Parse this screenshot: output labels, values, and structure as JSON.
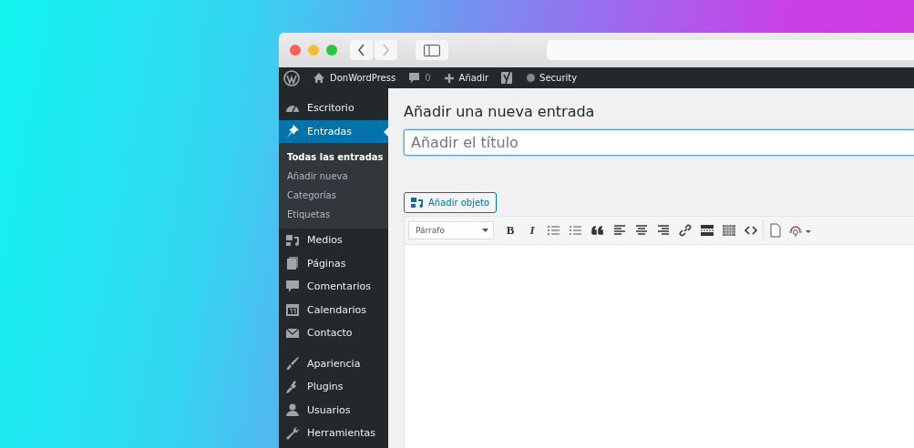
{
  "admin_bar": {
    "items": [
      {
        "kind": "home",
        "label": "DonWordPress"
      },
      {
        "kind": "comments",
        "label": "0"
      },
      {
        "kind": "add",
        "label": "Añadir"
      },
      {
        "kind": "seo"
      },
      {
        "kind": "security",
        "label": "Security"
      }
    ]
  },
  "sidebar": {
    "sections": [
      [
        {
          "label": "Escritorio",
          "selected": false
        },
        {
          "label": "Entradas",
          "selected": true,
          "children": [
            {
              "label": "Todas las entradas",
              "selected": true
            },
            {
              "label": "Añadir nueva",
              "selected": false
            },
            {
              "label": "Categorías",
              "selected": false
            },
            {
              "label": "Etiquetas",
              "selected": false
            }
          ]
        },
        {
          "label": "Medios",
          "selected": false
        },
        {
          "label": "Páginas",
          "selected": false
        },
        {
          "label": "Comentarios",
          "selected": false
        },
        {
          "label": "Calendarios",
          "selected": false
        },
        {
          "label": "Contacto",
          "selected": false
        }
      ],
      [
        {
          "label": "Apariencia",
          "selected": false
        },
        {
          "label": "Plugins",
          "selected": false
        },
        {
          "label": "Usuarios",
          "selected": false
        },
        {
          "label": "Herramientas",
          "selected": false
        }
      ]
    ]
  },
  "page_title": "Añadir una nueva entrada",
  "title_field": {
    "placeholder": "Añadir el título"
  },
  "add_media_button": "Añadir objeto",
  "editor": {
    "format_select": "Párrafo",
    "toolbar": [
      {
        "kind": "bold",
        "label": "B"
      },
      {
        "kind": "italic",
        "label": "I"
      },
      {
        "kind": "bullets"
      },
      {
        "kind": "numbers"
      },
      {
        "kind": "quote"
      },
      {
        "kind": "align-left"
      },
      {
        "kind": "align-center"
      },
      {
        "kind": "align-right"
      },
      {
        "kind": "link"
      },
      {
        "kind": "more"
      },
      {
        "kind": "kitchen"
      },
      {
        "kind": "code"
      },
      {
        "kind": "page"
      },
      {
        "kind": "special"
      }
    ]
  }
}
